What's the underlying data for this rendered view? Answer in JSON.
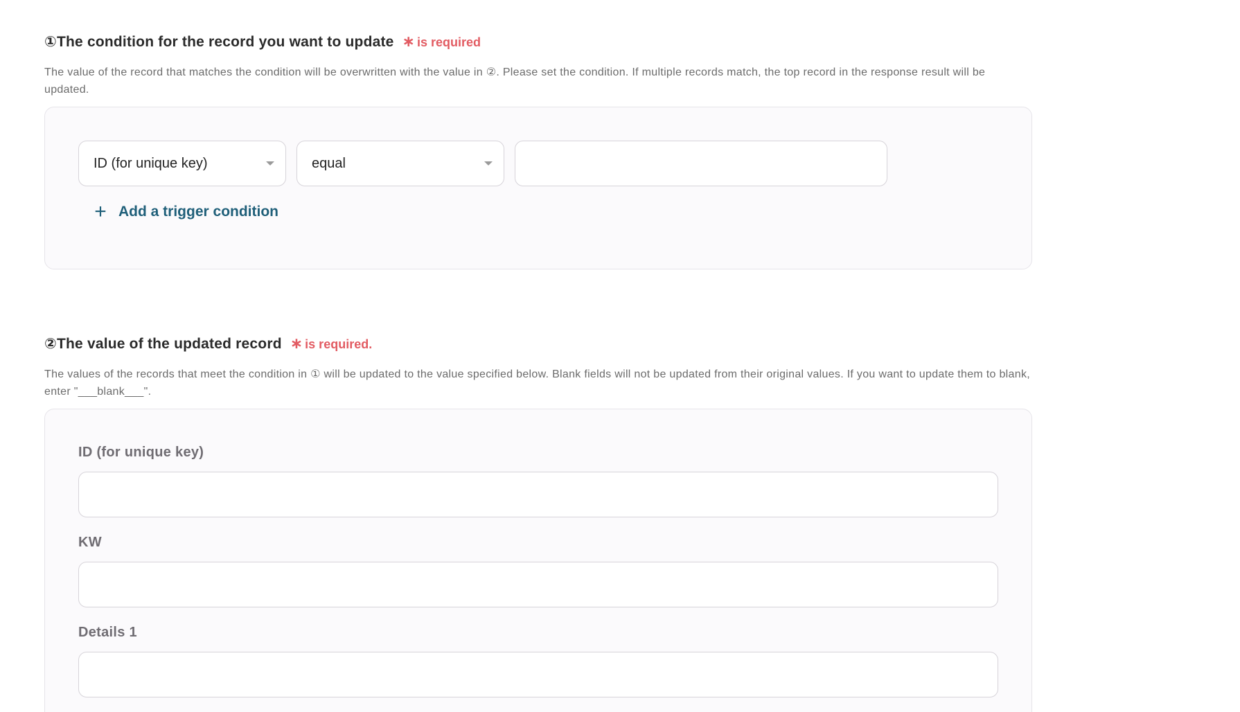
{
  "section1": {
    "title": "①The condition for the record you want to update",
    "required_star": "∗",
    "required_text": "is required",
    "description": "The value of the record that matches the condition will be overwritten with the value in ②. Please set the condition. If multiple records match, the top record in the response result will be updated.",
    "condition": {
      "field_select": "ID (for unique key)",
      "operator_select": "equal",
      "value": ""
    },
    "add_condition_label": "Add a trigger condition"
  },
  "section2": {
    "title": "②The value of the updated record",
    "required_star": "∗",
    "required_text": "is required.",
    "description": "The values of the records that meet the condition in ① will be updated to the value specified below. Blank fields will not be updated from their original values. If you want to update them to blank, enter \"___blank___\".",
    "fields": [
      {
        "label": "ID (for unique key)",
        "value": ""
      },
      {
        "label": "KW",
        "value": ""
      },
      {
        "label": "Details 1",
        "value": ""
      }
    ]
  },
  "colors": {
    "required": "#e25b62",
    "link": "#1f5f79",
    "panel_bg": "#fbfafc",
    "border": "#d6d3d9"
  },
  "icons": {
    "select_caret": "chevron-down-icon",
    "add": "plus-icon"
  }
}
